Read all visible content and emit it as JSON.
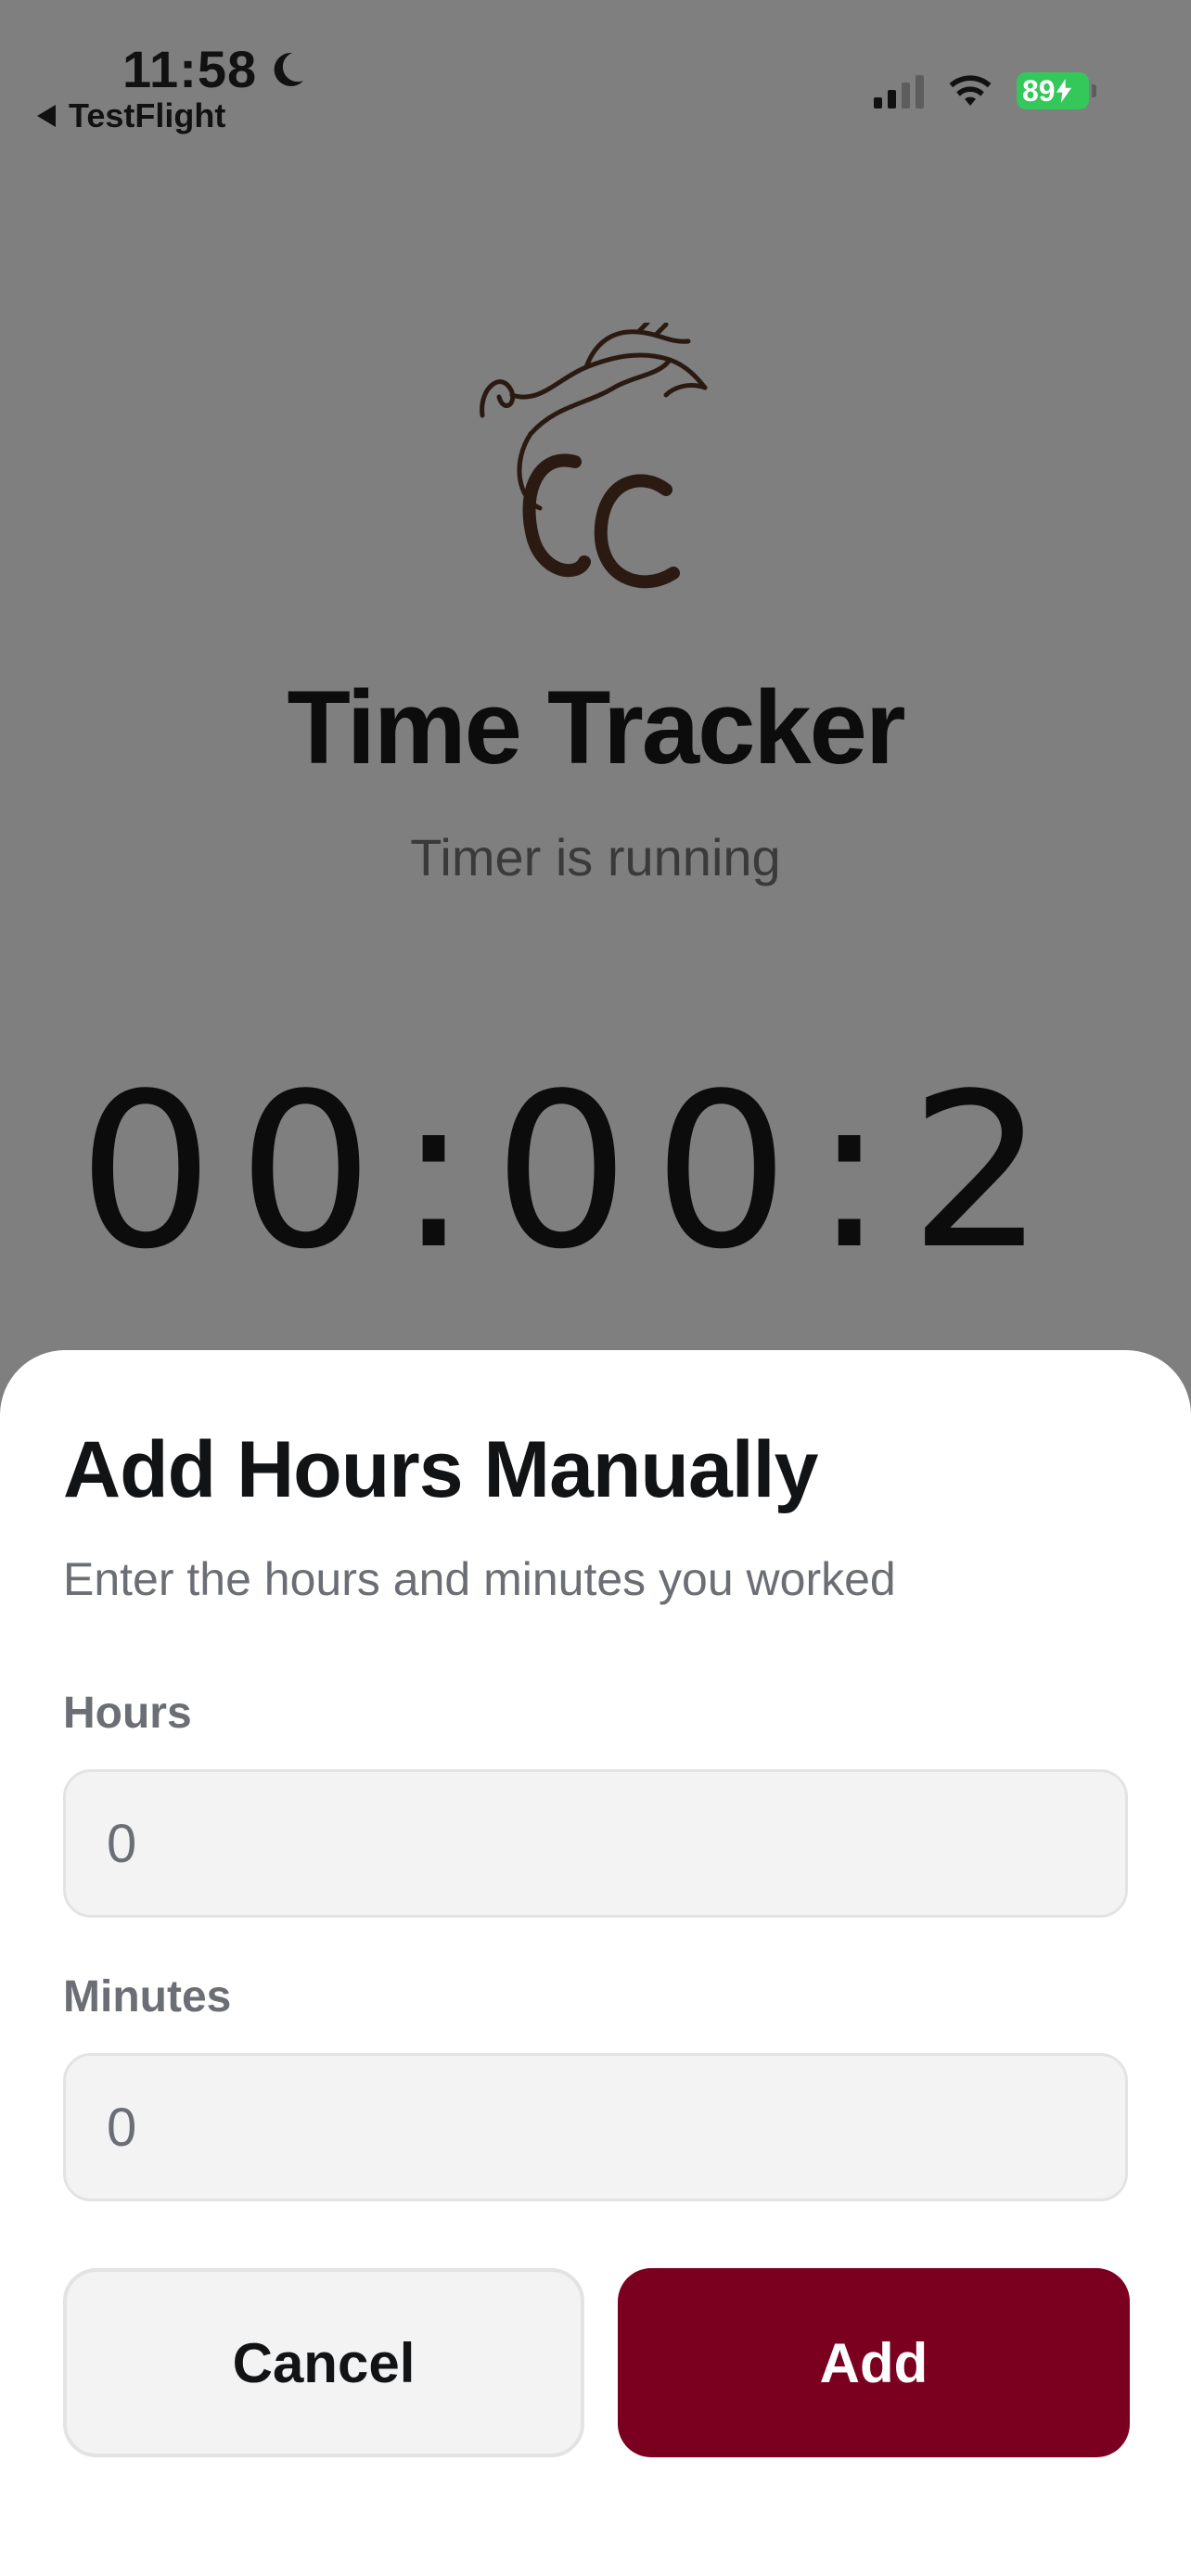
{
  "status_bar": {
    "time": "11:58",
    "back_app": "TestFlight",
    "battery_level": "89",
    "battery_color": "#34c759",
    "icons": [
      "moon-icon",
      "cellular-signal-icon",
      "wifi-icon",
      "battery-charging-icon"
    ]
  },
  "background": {
    "logo": "cc-horse-logo",
    "app_title": "Time Tracker",
    "timer_status": "Timer is running",
    "timer_display": "00:00:2"
  },
  "sheet": {
    "title": "Add Hours Manually",
    "subtitle": "Enter the hours and minutes you worked",
    "hours_label": "Hours",
    "hours_placeholder": "0",
    "minutes_label": "Minutes",
    "minutes_placeholder": "0",
    "cancel_label": "Cancel",
    "add_label": "Add",
    "accent_color": "#7b0020"
  }
}
